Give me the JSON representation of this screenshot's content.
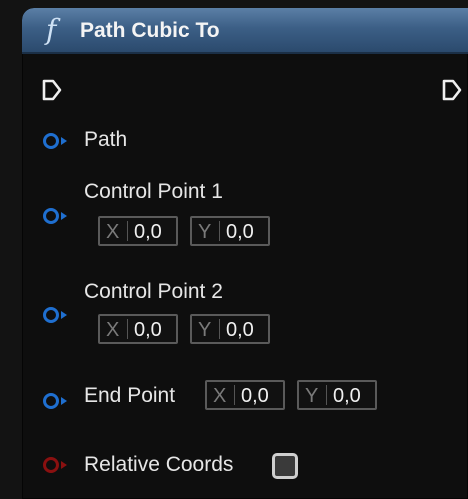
{
  "node": {
    "icon": "function-icon",
    "icon_glyph": "f",
    "title": "Path Cubic To"
  },
  "pins": {
    "path": {
      "label": "Path"
    },
    "control_point_1": {
      "label": "Control Point 1",
      "x_axis": "X",
      "x_value": "0,0",
      "y_axis": "Y",
      "y_value": "0,0"
    },
    "control_point_2": {
      "label": "Control Point 2",
      "x_axis": "X",
      "x_value": "0,0",
      "y_axis": "Y",
      "y_value": "0,0"
    },
    "end_point": {
      "label": "End Point",
      "x_axis": "X",
      "x_value": "0,0",
      "y_axis": "Y",
      "y_value": "0,0"
    },
    "relative_coords": {
      "label": "Relative Coords",
      "checked": false
    }
  },
  "colors": {
    "header": "#3c5f86",
    "struct_pin": "#1f6fd0",
    "bool_pin": "#8a1010",
    "exec_pin": "#f0f0f0"
  }
}
